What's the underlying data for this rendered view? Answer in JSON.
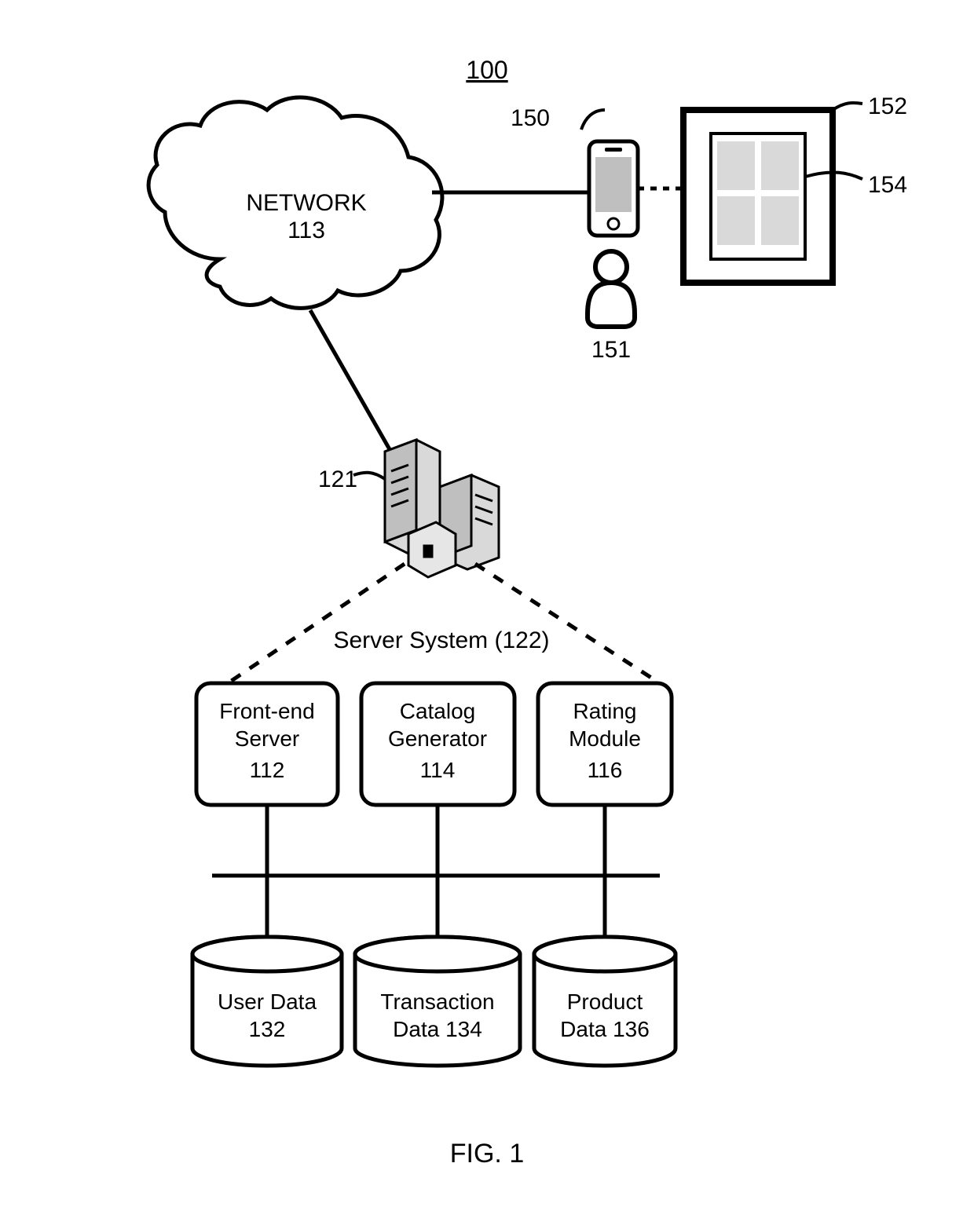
{
  "figureNumber": "100",
  "figureCaption": "FIG. 1",
  "network": {
    "label": "NETWORK",
    "number": "113"
  },
  "phone": {
    "number": "150"
  },
  "user": {
    "number": "151"
  },
  "poster": {
    "number": "152"
  },
  "catalog": {
    "number": "154"
  },
  "serverIcon": {
    "number": "121"
  },
  "serverSystem": {
    "label": "Server System (122)"
  },
  "modules": {
    "frontEnd": {
      "line1": "Front-end",
      "line2": "Server",
      "number": "112"
    },
    "catalogGen": {
      "line1": "Catalog",
      "line2": "Generator",
      "number": "114"
    },
    "rating": {
      "line1": "Rating",
      "line2": "Module",
      "number": "116"
    }
  },
  "databases": {
    "userData": {
      "line1": "User Data",
      "number": "132"
    },
    "transactionData": {
      "line1": "Transaction",
      "line2": "Data",
      "number": "134"
    },
    "productData": {
      "line1": "Product",
      "line2": "Data",
      "number": "136"
    }
  }
}
